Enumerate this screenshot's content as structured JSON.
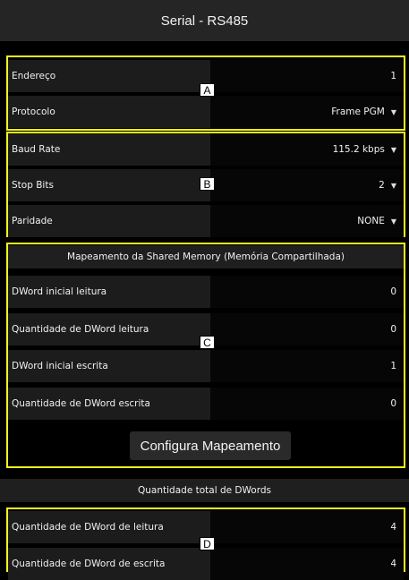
{
  "header": {
    "title": "Serial - RS485"
  },
  "groupA": {
    "marker": "A",
    "rows": [
      {
        "label": "Endereço",
        "value": "1"
      },
      {
        "label": "Protocolo",
        "value": "Frame PGM"
      }
    ]
  },
  "groupB": {
    "marker": "B",
    "rows": [
      {
        "label": "Baud Rate",
        "value": "115.2 kbps"
      },
      {
        "label": "Stop Bits",
        "value": "2"
      },
      {
        "label": "Paridade",
        "value": "NONE"
      }
    ]
  },
  "groupC": {
    "marker": "C",
    "title": "Mapeamento da Shared Memory (Memória Compartilhada)",
    "rows": [
      {
        "label": "DWord inicial leitura",
        "value": "0"
      },
      {
        "label": "Quantidade de DWord leitura",
        "value": "0"
      },
      {
        "label": "DWord inicial escrita",
        "value": "1"
      },
      {
        "label": "Quantidade de DWord escrita",
        "value": "0"
      }
    ],
    "button": "Configura Mapeamento"
  },
  "totals": {
    "title": "Quantidade total de DWords"
  },
  "groupD": {
    "marker": "D",
    "rows": [
      {
        "label": "Quantidade de DWord de leitura",
        "value": "4"
      },
      {
        "label": "Quantidade de DWord de escrita",
        "value": "4"
      }
    ]
  },
  "icons": {
    "dropdown": "caret-down-icon"
  },
  "colors": {
    "highlight": "#f5f51d",
    "background": "#000000"
  }
}
